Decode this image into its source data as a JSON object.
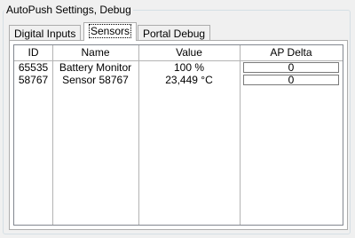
{
  "group": {
    "title": "AutoPush Settings, Debug"
  },
  "tabs": [
    {
      "label": "Digital Inputs",
      "active": false
    },
    {
      "label": "Sensors",
      "active": true
    },
    {
      "label": "Portal Debug",
      "active": false
    }
  ],
  "table": {
    "columns": [
      "ID",
      "Name",
      "Value",
      "AP Delta"
    ],
    "rows": [
      {
        "id": "65535",
        "name": "Battery Monitor",
        "value": "100 %",
        "ap_delta": "0"
      },
      {
        "id": "58767",
        "name": "Sensor 58767",
        "value": "23,449 °C",
        "ap_delta": "0"
      }
    ]
  }
}
